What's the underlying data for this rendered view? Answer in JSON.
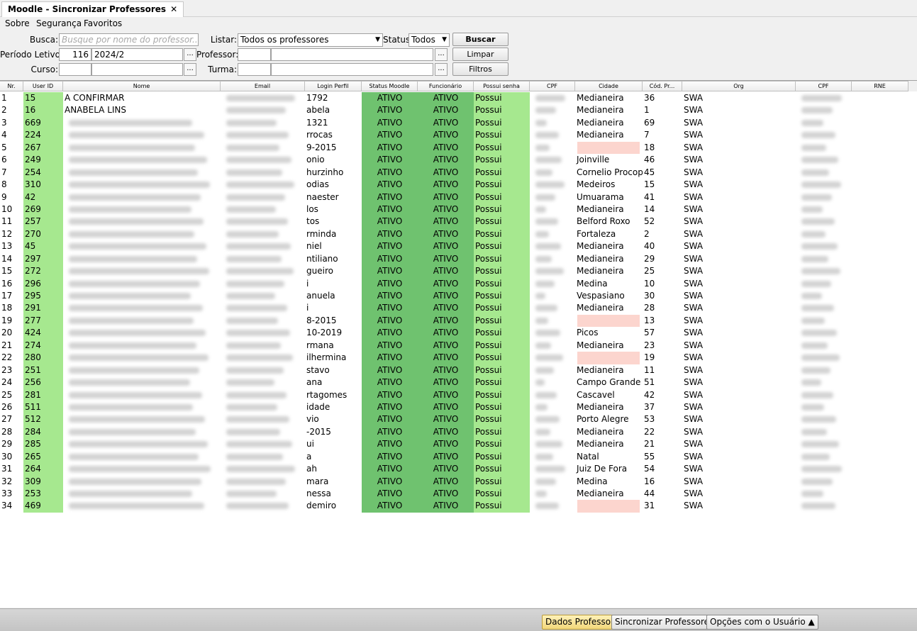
{
  "window": {
    "tab_title": "Moodle - Sincronizar Professores",
    "close_glyph": "✕"
  },
  "menu": [
    "Sobre",
    "Segurança",
    "Favoritos"
  ],
  "filters": {
    "busca_label": "Busca:",
    "busca_placeholder": "Busque por nome do professor...",
    "listar_label": "Listar:",
    "listar_value": "Todos os professores",
    "status_label": "Status:",
    "status_value": "Todos",
    "buscar_button": "Buscar",
    "periodo_label": "Período Letivo:",
    "periodo_code": "116",
    "periodo_value": "2024/2",
    "professor_label": "Professor:",
    "limpar_button": "Limpar",
    "curso_label": "Curso:",
    "turma_label": "Turma:",
    "filtros_button": "Filtros",
    "ellipsis": "..."
  },
  "table": {
    "columns": [
      "Nr.",
      "User ID",
      "Nome",
      "Email",
      "Login Perfil",
      "Status Moodle",
      "Funcionário",
      "Possui senha",
      "CPF",
      "Cidade",
      "Cód. Pr...",
      "Org",
      "CPF",
      "RNE"
    ],
    "rows": [
      {
        "nr": "1",
        "uid": "15",
        "nome": "A CONFIRMAR",
        "login": "1792",
        "sm": "ATIVO",
        "fu": "ATIVO",
        "ps": "Possui",
        "cidade": "Medianeira",
        "cod": "36",
        "org": "SWA"
      },
      {
        "nr": "2",
        "uid": "16",
        "nome": "ANABELA LINS",
        "login": "abela",
        "sm": "ATIVO",
        "fu": "ATIVO",
        "ps": "Possui",
        "cidade": "Medianeira",
        "cod": "1",
        "org": "SWA"
      },
      {
        "nr": "3",
        "uid": "669",
        "nome": "",
        "login": "1321",
        "sm": "ATIVO",
        "fu": "ATIVO",
        "ps": "Possui",
        "cidade": "Medianeira",
        "cod": "69",
        "org": "SWA"
      },
      {
        "nr": "4",
        "uid": "224",
        "nome": "",
        "login": "rrocas",
        "sm": "ATIVO",
        "fu": "ATIVO",
        "ps": "Possui",
        "cidade": "Medianeira",
        "cod": "7",
        "org": "SWA"
      },
      {
        "nr": "5",
        "uid": "267",
        "nome": "",
        "login": "9-2015",
        "sm": "ATIVO",
        "fu": "ATIVO",
        "ps": "Possui",
        "cidade": "",
        "cod": "18",
        "org": "SWA"
      },
      {
        "nr": "6",
        "uid": "249",
        "nome": "",
        "login": "onio",
        "sm": "ATIVO",
        "fu": "ATIVO",
        "ps": "Possui",
        "cidade": "Joinville",
        "cod": "46",
        "org": "SWA"
      },
      {
        "nr": "7",
        "uid": "254",
        "nome": "",
        "login": "hurzinho",
        "sm": "ATIVO",
        "fu": "ATIVO",
        "ps": "Possui",
        "cidade": "Cornelio Procop...",
        "cod": "45",
        "org": "SWA"
      },
      {
        "nr": "8",
        "uid": "310",
        "nome": "",
        "login": "odias",
        "sm": "ATIVO",
        "fu": "ATIVO",
        "ps": "Possui",
        "cidade": "Medeiros",
        "cod": "15",
        "org": "SWA"
      },
      {
        "nr": "9",
        "uid": "42",
        "nome": "",
        "login": "naester",
        "sm": "ATIVO",
        "fu": "ATIVO",
        "ps": "Possui",
        "cidade": "Umuarama",
        "cod": "41",
        "org": "SWA"
      },
      {
        "nr": "10",
        "uid": "269",
        "nome": "",
        "login": "los",
        "sm": "ATIVO",
        "fu": "ATIVO",
        "ps": "Possui",
        "cidade": "Medianeira",
        "cod": "14",
        "org": "SWA"
      },
      {
        "nr": "11",
        "uid": "257",
        "nome": "",
        "login": "tos",
        "sm": "ATIVO",
        "fu": "ATIVO",
        "ps": "Possui",
        "cidade": "Belford Roxo",
        "cod": "52",
        "org": "SWA"
      },
      {
        "nr": "12",
        "uid": "270",
        "nome": "",
        "login": "rminda",
        "sm": "ATIVO",
        "fu": "ATIVO",
        "ps": "Possui",
        "cidade": "Fortaleza",
        "cod": "2",
        "org": "SWA"
      },
      {
        "nr": "13",
        "uid": "45",
        "nome": "",
        "login": "niel",
        "sm": "ATIVO",
        "fu": "ATIVO",
        "ps": "Possui",
        "cidade": "Medianeira",
        "cod": "40",
        "org": "SWA"
      },
      {
        "nr": "14",
        "uid": "297",
        "nome": "",
        "login": "ntiliano",
        "sm": "ATIVO",
        "fu": "ATIVO",
        "ps": "Possui",
        "cidade": "Medianeira",
        "cod": "29",
        "org": "SWA"
      },
      {
        "nr": "15",
        "uid": "272",
        "nome": "",
        "login": "gueiro",
        "sm": "ATIVO",
        "fu": "ATIVO",
        "ps": "Possui",
        "cidade": "Medianeira",
        "cod": "25",
        "org": "SWA"
      },
      {
        "nr": "16",
        "uid": "296",
        "nome": "",
        "login": "i",
        "sm": "ATIVO",
        "fu": "ATIVO",
        "ps": "Possui",
        "cidade": "Medina",
        "cod": "10",
        "org": "SWA"
      },
      {
        "nr": "17",
        "uid": "295",
        "nome": "",
        "login": "anuela",
        "sm": "ATIVO",
        "fu": "ATIVO",
        "ps": "Possui",
        "cidade": "Vespasiano",
        "cod": "30",
        "org": "SWA"
      },
      {
        "nr": "18",
        "uid": "291",
        "nome": "",
        "login": "i",
        "sm": "ATIVO",
        "fu": "ATIVO",
        "ps": "Possui",
        "cidade": "Medianeira",
        "cod": "28",
        "org": "SWA"
      },
      {
        "nr": "19",
        "uid": "277",
        "nome": "",
        "login": "8-2015",
        "sm": "ATIVO",
        "fu": "ATIVO",
        "ps": "Possui",
        "cidade": "",
        "cod": "13",
        "org": "SWA"
      },
      {
        "nr": "20",
        "uid": "424",
        "nome": "",
        "login": "10-2019",
        "sm": "ATIVO",
        "fu": "ATIVO",
        "ps": "Possui",
        "cidade": "Picos",
        "cod": "57",
        "org": "SWA"
      },
      {
        "nr": "21",
        "uid": "274",
        "nome": "",
        "login": "rmana",
        "sm": "ATIVO",
        "fu": "ATIVO",
        "ps": "Possui",
        "cidade": "Medianeira",
        "cod": "23",
        "org": "SWA"
      },
      {
        "nr": "22",
        "uid": "280",
        "nome": "",
        "login": "ilhermina",
        "sm": "ATIVO",
        "fu": "ATIVO",
        "ps": "Possui",
        "cidade": "",
        "cod": "19",
        "org": "SWA"
      },
      {
        "nr": "23",
        "uid": "251",
        "nome": "",
        "login": "stavo",
        "sm": "ATIVO",
        "fu": "ATIVO",
        "ps": "Possui",
        "cidade": "Medianeira",
        "cod": "11",
        "org": "SWA"
      },
      {
        "nr": "24",
        "uid": "256",
        "nome": "",
        "login": "ana",
        "sm": "ATIVO",
        "fu": "ATIVO",
        "ps": "Possui",
        "cidade": "Campo Grande",
        "cod": "51",
        "org": "SWA"
      },
      {
        "nr": "25",
        "uid": "281",
        "nome": "",
        "login": "rtagomes",
        "sm": "ATIVO",
        "fu": "ATIVO",
        "ps": "Possui",
        "cidade": "Cascavel",
        "cod": "42",
        "org": "SWA"
      },
      {
        "nr": "26",
        "uid": "511",
        "nome": "",
        "login": "idade",
        "sm": "ATIVO",
        "fu": "ATIVO",
        "ps": "Possui",
        "cidade": "Medianeira",
        "cod": "37",
        "org": "SWA"
      },
      {
        "nr": "27",
        "uid": "512",
        "nome": "",
        "login": "vio",
        "sm": "ATIVO",
        "fu": "ATIVO",
        "ps": "Possui",
        "cidade": "Porto Alegre",
        "cod": "53",
        "org": "SWA"
      },
      {
        "nr": "28",
        "uid": "284",
        "nome": "",
        "login": "-2015",
        "sm": "ATIVO",
        "fu": "ATIVO",
        "ps": "Possui",
        "cidade": "Medianeira",
        "cod": "22",
        "org": "SWA"
      },
      {
        "nr": "29",
        "uid": "285",
        "nome": "",
        "login": "ui",
        "sm": "ATIVO",
        "fu": "ATIVO",
        "ps": "Possui",
        "cidade": "Medianeira",
        "cod": "21",
        "org": "SWA"
      },
      {
        "nr": "30",
        "uid": "265",
        "nome": "",
        "login": "a",
        "sm": "ATIVO",
        "fu": "ATIVO",
        "ps": "Possui",
        "cidade": "Natal",
        "cod": "55",
        "org": "SWA"
      },
      {
        "nr": "31",
        "uid": "264",
        "nome": "",
        "login": "ah",
        "sm": "ATIVO",
        "fu": "ATIVO",
        "ps": "Possui",
        "cidade": "Juiz De Fora",
        "cod": "54",
        "org": "SWA"
      },
      {
        "nr": "32",
        "uid": "309",
        "nome": "",
        "login": "mara",
        "sm": "ATIVO",
        "fu": "ATIVO",
        "ps": "Possui",
        "cidade": "Medina",
        "cod": "16",
        "org": "SWA"
      },
      {
        "nr": "33",
        "uid": "253",
        "nome": "",
        "login": "nessa",
        "sm": "ATIVO",
        "fu": "ATIVO",
        "ps": "Possui",
        "cidade": "Medianeira",
        "cod": "44",
        "org": "SWA"
      },
      {
        "nr": "34",
        "uid": "469",
        "nome": "",
        "login": "demiro",
        "sm": "ATIVO",
        "fu": "ATIVO",
        "ps": "Possui",
        "cidade": "",
        "cod": "31",
        "org": "SWA"
      }
    ]
  },
  "footer": {
    "dados_button": "Dados Professor",
    "sincronizar_button": "Sincronizar Professores",
    "opcoes_button": "Opções com o Usuário ▲"
  },
  "colors": {
    "status_green": "#6fc26f",
    "light_green": "#a6e88f",
    "missing_city": "#fcd5ce",
    "active_button": "#f2d77a"
  }
}
